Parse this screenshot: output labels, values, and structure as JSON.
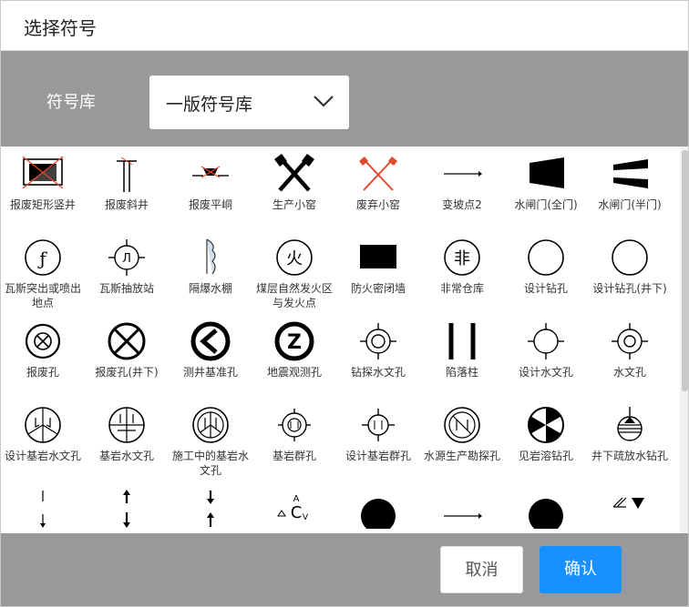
{
  "dialog": {
    "title": "选择符号"
  },
  "filter": {
    "label": "符号库",
    "selected": "一版符号库"
  },
  "symbols": [
    {
      "label": "报废矩形竖井",
      "icon": "scrapped-rect-shaft-icon"
    },
    {
      "label": "报废斜井",
      "icon": "scrapped-incline-shaft-icon"
    },
    {
      "label": "报废平峒",
      "icon": "scrapped-adit-icon"
    },
    {
      "label": "生产小窑",
      "icon": "producing-small-mine-icon"
    },
    {
      "label": "废弃小窑",
      "icon": "abandoned-small-mine-icon"
    },
    {
      "label": "变坡点2",
      "icon": "slope-change-point-icon"
    },
    {
      "label": "水闸门(全门)",
      "icon": "water-gate-full-icon"
    },
    {
      "label": "水闸门(半门)",
      "icon": "water-gate-half-icon"
    },
    {
      "label": "瓦斯突出或喷出地点",
      "icon": "gas-outburst-point-icon"
    },
    {
      "label": "瓦斯抽放站",
      "icon": "gas-drainage-station-icon"
    },
    {
      "label": "隔爆水棚",
      "icon": "explosion-water-shed-icon"
    },
    {
      "label": "煤层自然发火区与发火点",
      "icon": "spontaneous-fire-icon"
    },
    {
      "label": "防火密闭墙",
      "icon": "fire-seal-wall-icon"
    },
    {
      "label": "非常仓库",
      "icon": "emergency-warehouse-icon"
    },
    {
      "label": "设计钻孔",
      "icon": "design-borehole-icon"
    },
    {
      "label": "设计钻孔(井下)",
      "icon": "design-borehole-underground-icon"
    },
    {
      "label": "报废孔",
      "icon": "scrapped-hole-icon"
    },
    {
      "label": "报废孔(井下)",
      "icon": "scrapped-hole-underground-icon"
    },
    {
      "label": "测井基准孔",
      "icon": "logging-reference-hole-icon"
    },
    {
      "label": "地震观测孔",
      "icon": "seismic-observation-hole-icon"
    },
    {
      "label": "钻探水文孔",
      "icon": "drilling-hydro-hole-icon"
    },
    {
      "label": "陷落柱",
      "icon": "collapse-column-icon"
    },
    {
      "label": "设计水文孔",
      "icon": "design-hydro-hole-icon"
    },
    {
      "label": "水文孔",
      "icon": "hydro-hole-icon"
    },
    {
      "label": "设计基岩水文孔",
      "icon": "design-bedrock-hydro-hole-icon"
    },
    {
      "label": "基岩水文孔",
      "icon": "bedrock-hydro-hole-icon"
    },
    {
      "label": "施工中的基岩水文孔",
      "icon": "bedrock-hydro-hole-in-progress-icon"
    },
    {
      "label": "基岩群孔",
      "icon": "bedrock-group-hole-icon"
    },
    {
      "label": "设计基岩群孔",
      "icon": "design-bedrock-group-hole-icon"
    },
    {
      "label": "水源生产勘探孔",
      "icon": "water-source-exploration-hole-icon"
    },
    {
      "label": "见岩溶钻孔",
      "icon": "karst-borehole-icon"
    },
    {
      "label": "井下疏放水钻孔",
      "icon": "underground-drainage-borehole-icon"
    },
    {
      "label": "",
      "icon": "thin-arrows-icon"
    },
    {
      "label": "",
      "icon": "bold-arrows-icon"
    },
    {
      "label": "",
      "icon": "reverse-arrows-icon"
    },
    {
      "label": "",
      "icon": "triangle-c-symbol-icon"
    },
    {
      "label": "",
      "icon": "filled-circle-icon"
    },
    {
      "label": "",
      "icon": "line-arrow-icon"
    },
    {
      "label": "",
      "icon": "filled-circle-large-icon"
    },
    {
      "label": "",
      "icon": "hatch-triangle-icon"
    }
  ],
  "glyphs": {
    "gas_box": "ƒ",
    "gas_station": "Л",
    "fire": "火",
    "warehouse": "非",
    "seismic": "Z",
    "tri_c_top": "A",
    "tri_c_mid": "C",
    "tri_c_bottom": "V"
  },
  "footer": {
    "cancel": "取消",
    "confirm": "确认"
  },
  "colors": {
    "accent": "#1890ff",
    "band": "#999999",
    "abandoned": "#e0492c"
  }
}
